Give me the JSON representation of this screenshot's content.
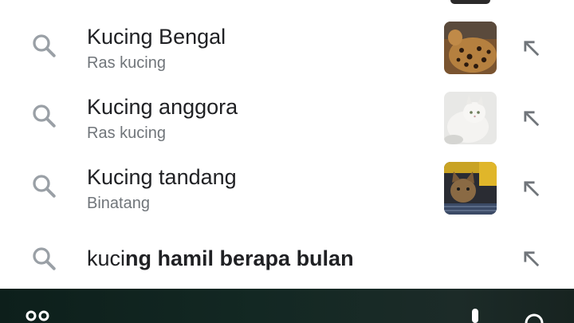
{
  "suggestions": [
    {
      "title": "Kucing Bengal",
      "subtitle": "Ras kucing",
      "thumbnail": "bengal-cat-photo"
    },
    {
      "title": "Kucing anggora",
      "subtitle": "Ras kucing",
      "thumbnail": "angora-cat-photo"
    },
    {
      "title": "Kucing tandang",
      "subtitle": "Binatang",
      "thumbnail": "kitten-in-cage-photo"
    }
  ],
  "query_suggestion": {
    "typed": "kuci",
    "completion": "ng hamil berapa bulan"
  },
  "icons": {
    "search": "search-icon",
    "fill": "fill-query-arrow-icon",
    "nav_left": "bubbles-icon",
    "nav_mid": "mic-icon",
    "nav_right": "lens-icon"
  },
  "colors": {
    "title": "#202124",
    "subtitle": "#70757a",
    "icon": "#9aa0a6",
    "nav_bar": "#132823"
  }
}
